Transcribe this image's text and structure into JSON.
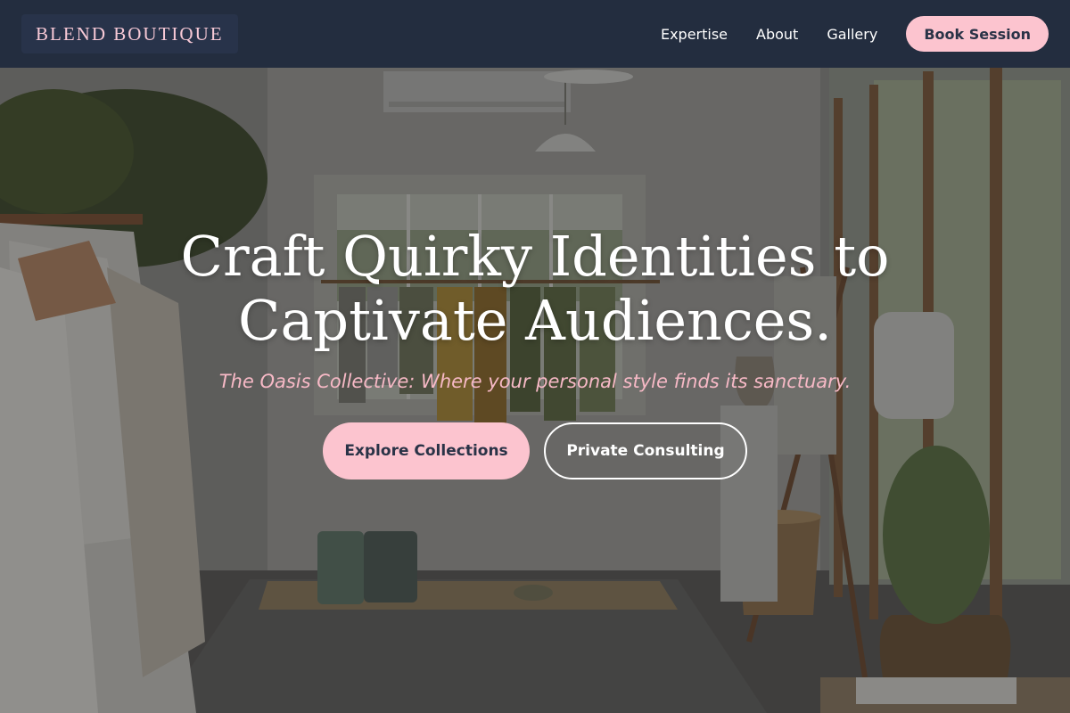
{
  "brand": {
    "name": "BLEND BOUTIQUE"
  },
  "nav": {
    "links": [
      "Expertise",
      "About",
      "Gallery"
    ],
    "cta_label": "Book Session"
  },
  "hero": {
    "title_line1": "Craft Quirky Identities to",
    "title_line2": "Captivate Audiences.",
    "subtitle": "The Oasis Collective: Where your personal style finds its sanctuary.",
    "primary_button": "Explore Collections",
    "secondary_button": "Private Consulting"
  },
  "colors": {
    "nav_background": "#232d3f",
    "accent_pink": "#fcc4cf",
    "subtitle_pink": "#f7b9c6",
    "text_white": "#ffffff"
  }
}
